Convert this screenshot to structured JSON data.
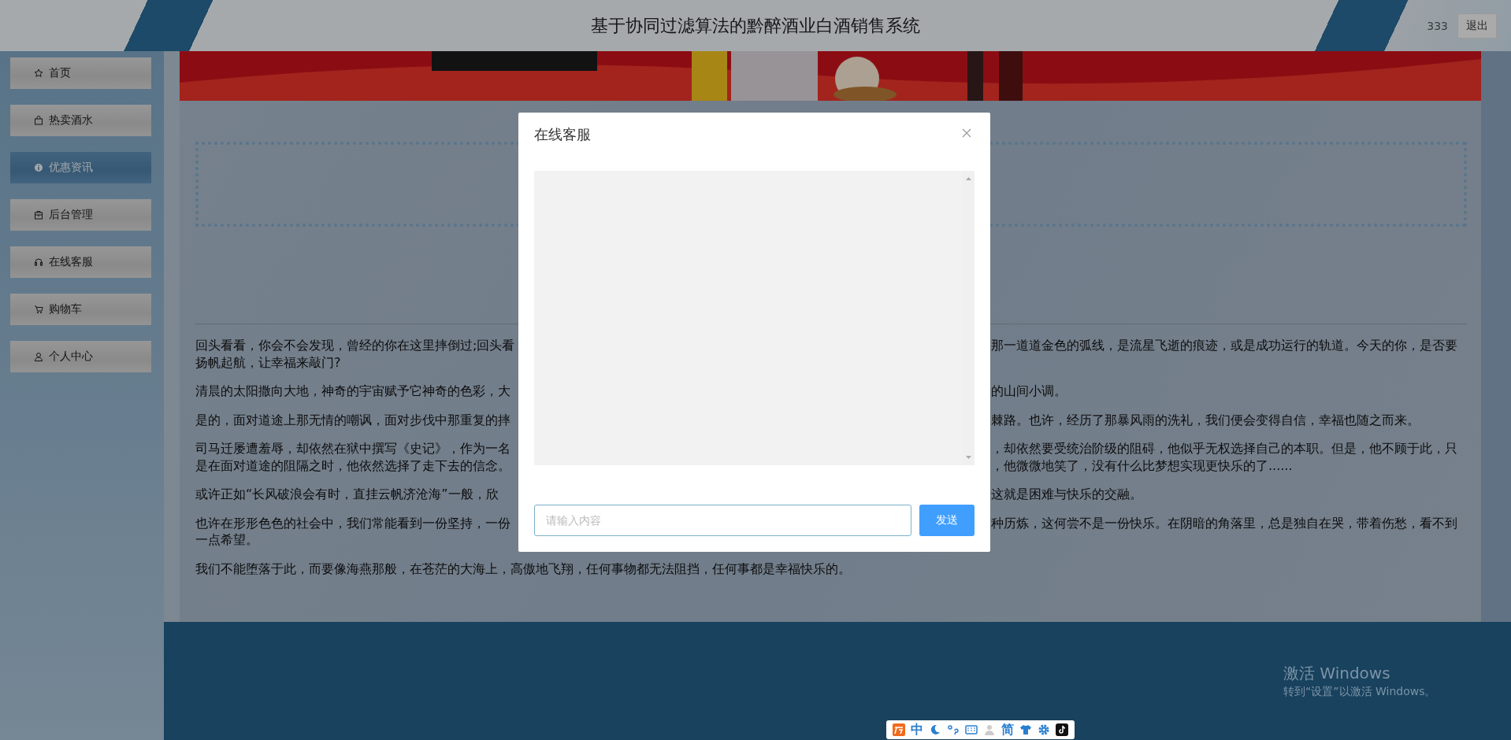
{
  "header": {
    "title": "基于协同过滤算法的黔醉酒业白酒销售系统",
    "user": "333",
    "logout": "退出"
  },
  "sidebar": {
    "items": [
      {
        "label": "首页",
        "selected": false
      },
      {
        "label": "热卖酒水",
        "selected": false
      },
      {
        "label": "优惠资讯",
        "selected": true
      },
      {
        "label": "后台管理",
        "selected": false
      },
      {
        "label": "在线客服",
        "selected": false
      },
      {
        "label": "购物车",
        "selected": false
      },
      {
        "label": "个人中心",
        "selected": false
      }
    ]
  },
  "article": {
    "paragraphs": [
      {
        "lines": [
          {
            "left": "回头看看，你会不会发现，曾经的你在这里摔倒过;回头看",
            "right": "那一道道金色的弧线，是流星飞逝的痕迹，或是成功运行的轨道。今天的你，是否要"
          },
          {
            "left": "扬帆起航，让幸福来敲门?"
          }
        ]
      },
      {
        "lines": [
          {
            "left": "清晨的太阳撒向大地，神奇的宇宙赋予它神奇的色彩，大",
            "right": "的山间小调。"
          }
        ]
      },
      {
        "lines": [
          {
            "left": "是的，面对道途上那无情的嘲讽，面对步伐中那重复的摔",
            "right": "棘路。也许，经历了那暴风雨的洗礼，我们便会变得自信，幸福也随之而来。"
          }
        ]
      },
      {
        "lines": [
          {
            "left": "司马迁屡遭羞辱，却依然在狱中撰写《史记》，作为一名",
            "right": "，却依然要受统治阶级的阻碍，他似乎无权选择自己的本职。但是，他不顾于此，只"
          },
          {
            "left": "是在面对道途的阻隔之时，他依然选择了走下去的信念。",
            "right": "，他微微地笑了，没有什么比梦想实现更快乐的了......"
          }
        ]
      },
      {
        "lines": [
          {
            "left": "或许正如“长风破浪会有时，直挂云帆济沧海”一般，欣",
            "right": "这就是困难与快乐的交融。"
          }
        ]
      },
      {
        "lines": [
          {
            "left": "也许在形形色色的社会中，我们常能看到一份坚持，一份",
            "right": "种历炼，这何尝不是一份快乐。在阴暗的角落里，总是独自在哭，带着伤愁，看不到"
          },
          {
            "left": "一点希望。"
          }
        ]
      },
      {
        "lines": [
          {
            "left": "我们不能堕落于此，而要像海燕那般，在苍茫的大海上，高傲地飞翔，任何事物都无法阻挡，任何事都是幸福快乐的。"
          }
        ]
      }
    ]
  },
  "dialog": {
    "title": "在线客服",
    "input": {
      "placeholder": "请输入内容"
    },
    "send": "发送"
  },
  "windows_notice": {
    "title": "激活 Windows",
    "subtitle": "转到“设置”以激活 Windows。"
  },
  "ime_bar": {
    "mode": "中",
    "script": "简"
  }
}
